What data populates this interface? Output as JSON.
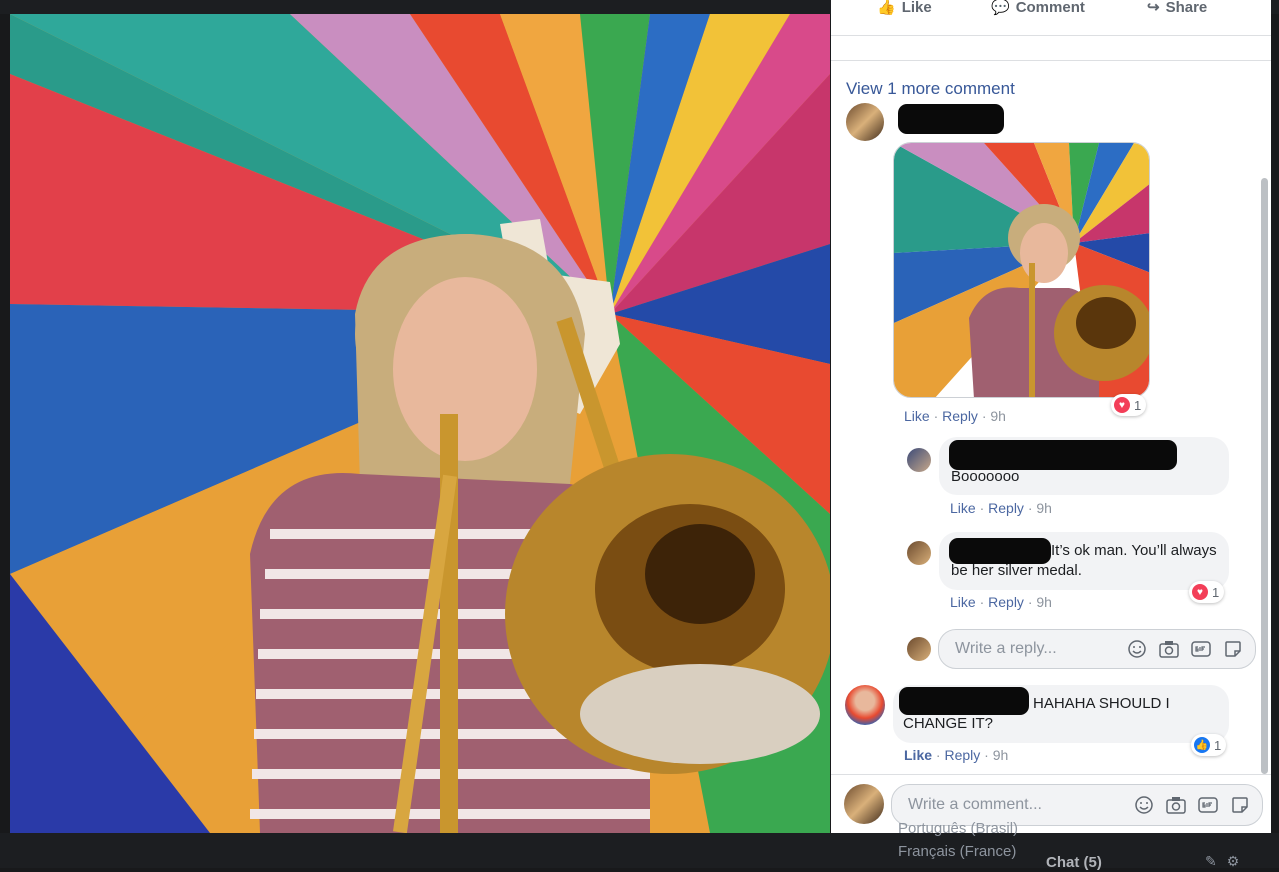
{
  "actions": {
    "like": "Like",
    "comment": "Comment",
    "share": "Share"
  },
  "view_more": "View 1 more comment",
  "comments": [
    {
      "meta": {
        "like": "Like",
        "reply": "Reply",
        "time": "9h"
      },
      "reaction_count": "1",
      "reaction": "love"
    },
    {
      "text": "Booooooo",
      "meta": {
        "like": "Like",
        "reply": "Reply",
        "time": "9h"
      }
    },
    {
      "text": "It’s ok man. You’ll always be her silver medal.",
      "meta": {
        "like": "Like",
        "reply": "Reply",
        "time": "9h"
      },
      "reaction_count": "1",
      "reaction": "love"
    },
    {
      "text": "HAHAHA SHOULD I CHANGE IT?",
      "meta": {
        "like": "Like",
        "reply": "Reply",
        "time": "9h"
      },
      "reaction_count": "1",
      "reaction": "like"
    }
  ],
  "reply_input": {
    "placeholder": "Write a reply..."
  },
  "comment_input": {
    "placeholder": "Write a comment..."
  },
  "input_icons": [
    "emoji-icon",
    "camera-icon",
    "gif-icon",
    "sticker-icon"
  ],
  "footer": {
    "lang1": "Português (Brasil)",
    "lang2": "Français (France)",
    "chat": "Chat (5)"
  },
  "colors": {
    "link": "#385898",
    "love": "#f33e58",
    "like": "#1877f2",
    "bubble": "#f2f3f5"
  }
}
